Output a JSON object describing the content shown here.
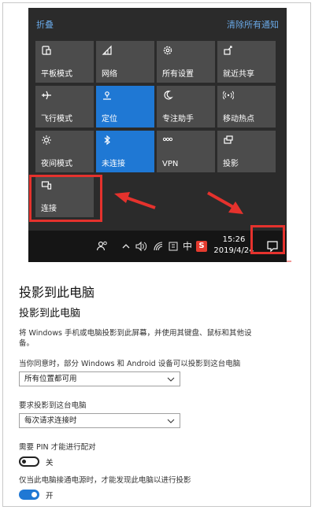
{
  "action_center": {
    "collapse_label": "折叠",
    "clear_label": "清除所有通知",
    "tiles": [
      {
        "label": "平板模式",
        "icon": "tablet-mode-icon",
        "active": false
      },
      {
        "label": "网络",
        "icon": "network-icon",
        "active": false
      },
      {
        "label": "所有设置",
        "icon": "gear-icon",
        "active": false
      },
      {
        "label": "就近共享",
        "icon": "nearby-share-icon",
        "active": false
      },
      {
        "label": "飞行模式",
        "icon": "airplane-icon",
        "active": false
      },
      {
        "label": "定位",
        "icon": "location-icon",
        "active": true
      },
      {
        "label": "专注助手",
        "icon": "moon-icon",
        "active": false
      },
      {
        "label": "移动热点",
        "icon": "hotspot-icon",
        "active": false
      },
      {
        "label": "夜间模式",
        "icon": "brightness-icon",
        "active": false
      },
      {
        "label": "未连接",
        "icon": "bluetooth-icon",
        "active": true
      },
      {
        "label": "VPN",
        "icon": "vpn-icon",
        "active": false
      },
      {
        "label": "投影",
        "icon": "project-icon",
        "active": false
      },
      {
        "label": "连接",
        "icon": "connect-icon",
        "active": false
      }
    ]
  },
  "taskbar": {
    "ime_label": "中",
    "sogou_label": "S",
    "time": "15:26",
    "date": "2019/4/24"
  },
  "settings": {
    "page_title": "投影到此电脑",
    "section_title": "投影到此电脑",
    "description": "将 Windows 手机或电脑投影到此屏幕，并使用其键盘、鼠标和其他设备。",
    "q1_label": "当你同意时，部分 Windows 和 Android 设备可以投影到这台电脑",
    "q1_value": "所有位置都可用",
    "q2_label": "要求投影到这台电脑",
    "q2_value": "每次请求连接时",
    "pin_label": "需要 PIN 才能进行配对",
    "pin_state": "关",
    "power_label": "仅当此电脑接通电源时，才能发现此电脑以进行投影",
    "power_state": "开"
  },
  "colors": {
    "accent": "#1f78d4",
    "annotation": "#e5322d",
    "panel": "#2b2b2b",
    "tile": "#4c4c4c"
  }
}
